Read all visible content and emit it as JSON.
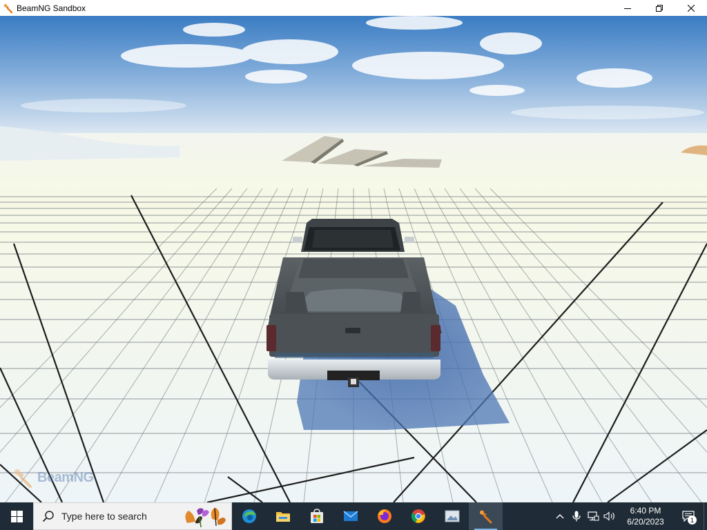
{
  "window": {
    "title": "BeamNG Sandbox",
    "controls": {
      "minimize": "—",
      "maximize": "❐",
      "close": "✕"
    }
  },
  "viewport": {
    "watermark_text": "BeamNG",
    "sky_top": "#3f7fc4",
    "sky_bottom": "#dbe8f4",
    "ground": "#f1f6f2",
    "vehicle_color": "#4f5558"
  },
  "taskbar": {
    "search_placeholder": "Type here to search",
    "apps": [
      {
        "name": "Microsoft Edge",
        "icon": "edge-icon"
      },
      {
        "name": "File Explorer",
        "icon": "folder-icon"
      },
      {
        "name": "Microsoft Store",
        "icon": "store-icon"
      },
      {
        "name": "Mail",
        "icon": "mail-icon"
      },
      {
        "name": "Firefox",
        "icon": "firefox-icon"
      },
      {
        "name": "Google Chrome",
        "icon": "chrome-icon"
      },
      {
        "name": "Photos",
        "icon": "photos-icon"
      },
      {
        "name": "BeamNG",
        "icon": "beamng-icon"
      }
    ],
    "tray": {
      "chevron": "^",
      "time": "6:40 PM",
      "date": "6/20/2023",
      "notification_count": "1"
    }
  }
}
